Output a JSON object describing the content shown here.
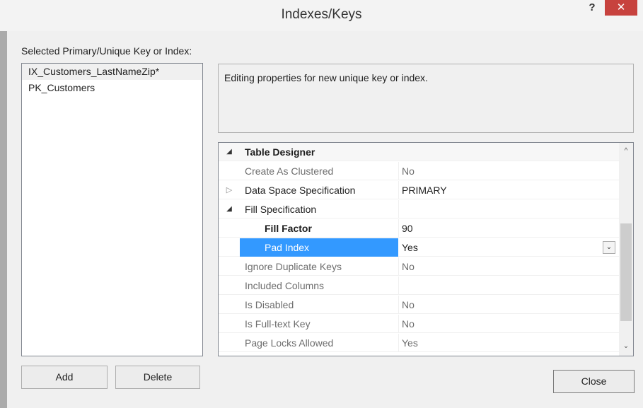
{
  "window": {
    "title": "Indexes/Keys",
    "help_label": "?",
    "close_label": "✕"
  },
  "keys_section": {
    "label": "Selected Primary/Unique Key or Index:",
    "items": [
      {
        "label": "IX_Customers_LastNameZip*"
      },
      {
        "label": "PK_Customers"
      }
    ]
  },
  "description": "Editing properties for new unique key or index.",
  "properties": {
    "rows": [
      {
        "glyph": "◢",
        "name": "Table Designer",
        "value": ""
      },
      {
        "glyph": "",
        "name": "Create As Clustered",
        "value": "No"
      },
      {
        "glyph": "▷",
        "name": "Data Space Specification",
        "value": "PRIMARY"
      },
      {
        "glyph": "◢",
        "name": "Fill Specification",
        "value": ""
      },
      {
        "glyph": "",
        "name": "Fill Factor",
        "value": "90"
      },
      {
        "glyph": "",
        "name": "Pad Index",
        "value": "Yes"
      },
      {
        "glyph": "",
        "name": "Ignore Duplicate Keys",
        "value": "No"
      },
      {
        "glyph": "",
        "name": "Included Columns",
        "value": ""
      },
      {
        "glyph": "",
        "name": "Is Disabled",
        "value": "No"
      },
      {
        "glyph": "",
        "name": "Is Full-text Key",
        "value": "No"
      },
      {
        "glyph": "",
        "name": "Page Locks Allowed",
        "value": "Yes"
      }
    ],
    "dropdown_glyph": "⌄",
    "scroll_up_glyph": "^",
    "scroll_down_glyph": "⌄"
  },
  "buttons": {
    "add": "Add",
    "delete": "Delete",
    "close": "Close"
  },
  "icons": {
    "help": "question-mark-icon",
    "close": "close-icon",
    "expand": "expand-triangle-icon",
    "collapse": "collapse-triangle-icon",
    "dropdown": "chevron-down-icon"
  },
  "colors": {
    "selection": "#3399ff",
    "close_button": "#c7423e"
  }
}
